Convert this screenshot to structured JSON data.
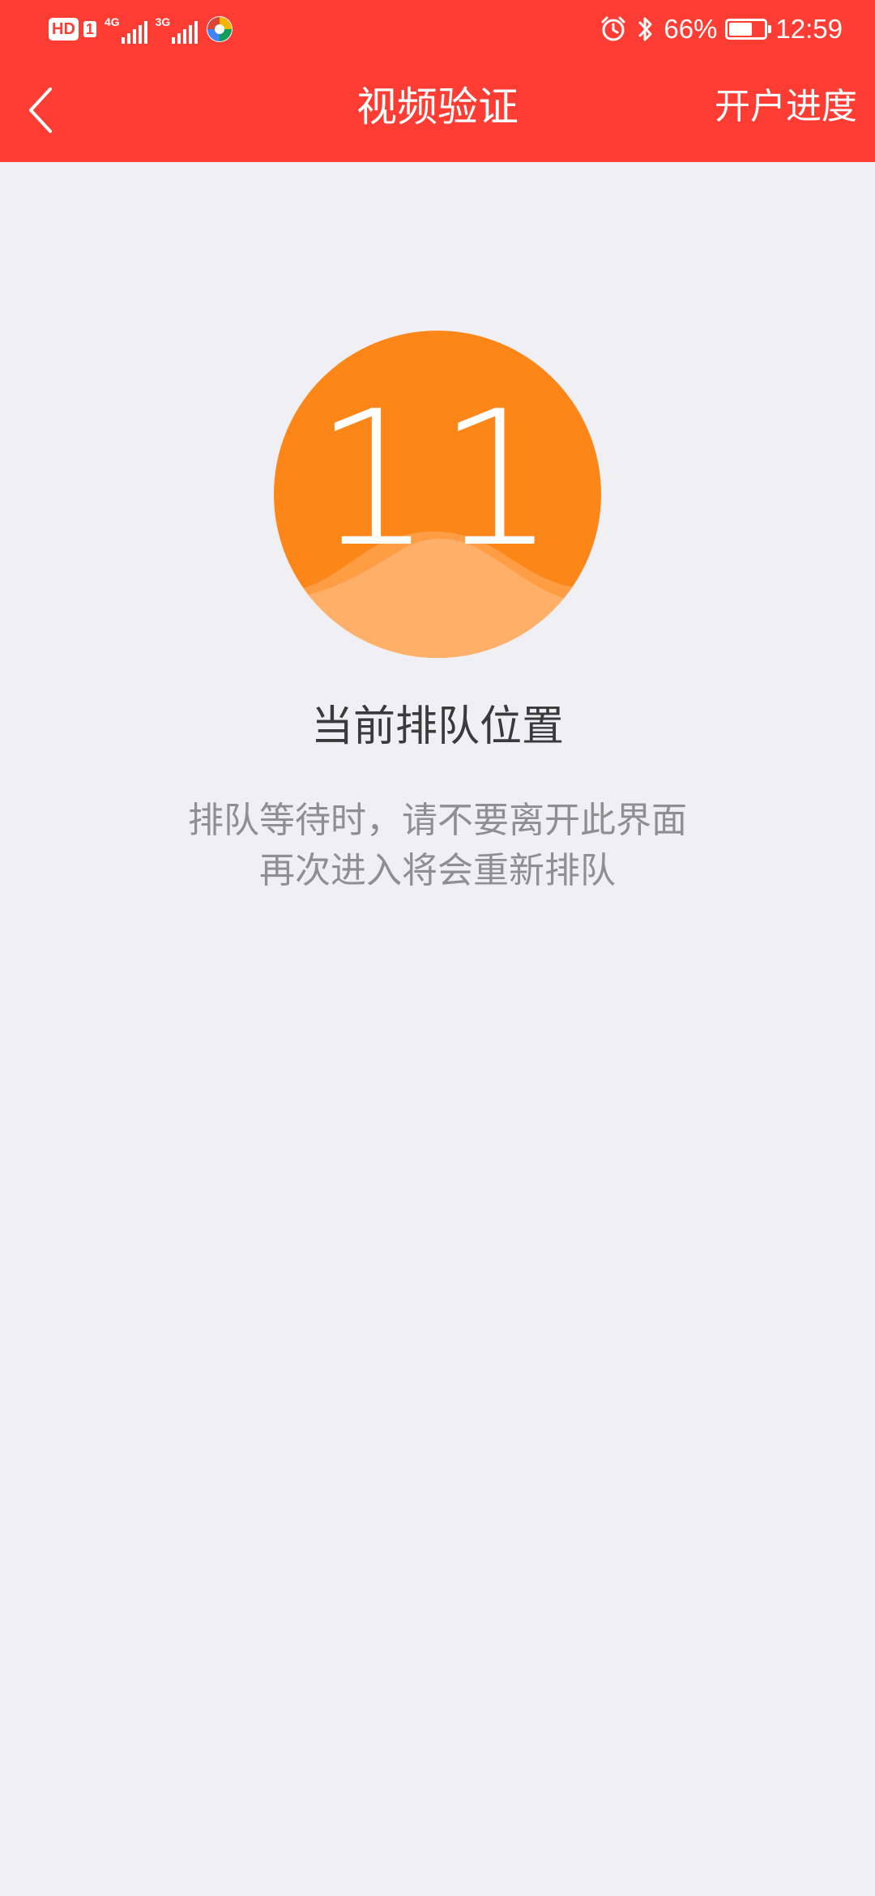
{
  "status_bar": {
    "hd_label": "HD",
    "sim_slot": "1",
    "network_1": "4G",
    "network_2": "3G",
    "battery_percent_text": "66%",
    "battery_level": 0.66,
    "time": "12:59",
    "icons": [
      "alarm-icon",
      "bluetooth-icon",
      "battery-icon"
    ]
  },
  "nav": {
    "title": "视频验证",
    "right_action": "开户进度",
    "back_icon": "chevron-left-icon"
  },
  "queue": {
    "position": "11",
    "label": "当前排队位置",
    "hint_line_1": "排队等待时，请不要离开此界面",
    "hint_line_2": "再次进入将会重新排队"
  },
  "colors": {
    "header": "#fd3d34",
    "background": "#f0eff4",
    "circle": "#fd8618",
    "wave": "#ffb068"
  }
}
